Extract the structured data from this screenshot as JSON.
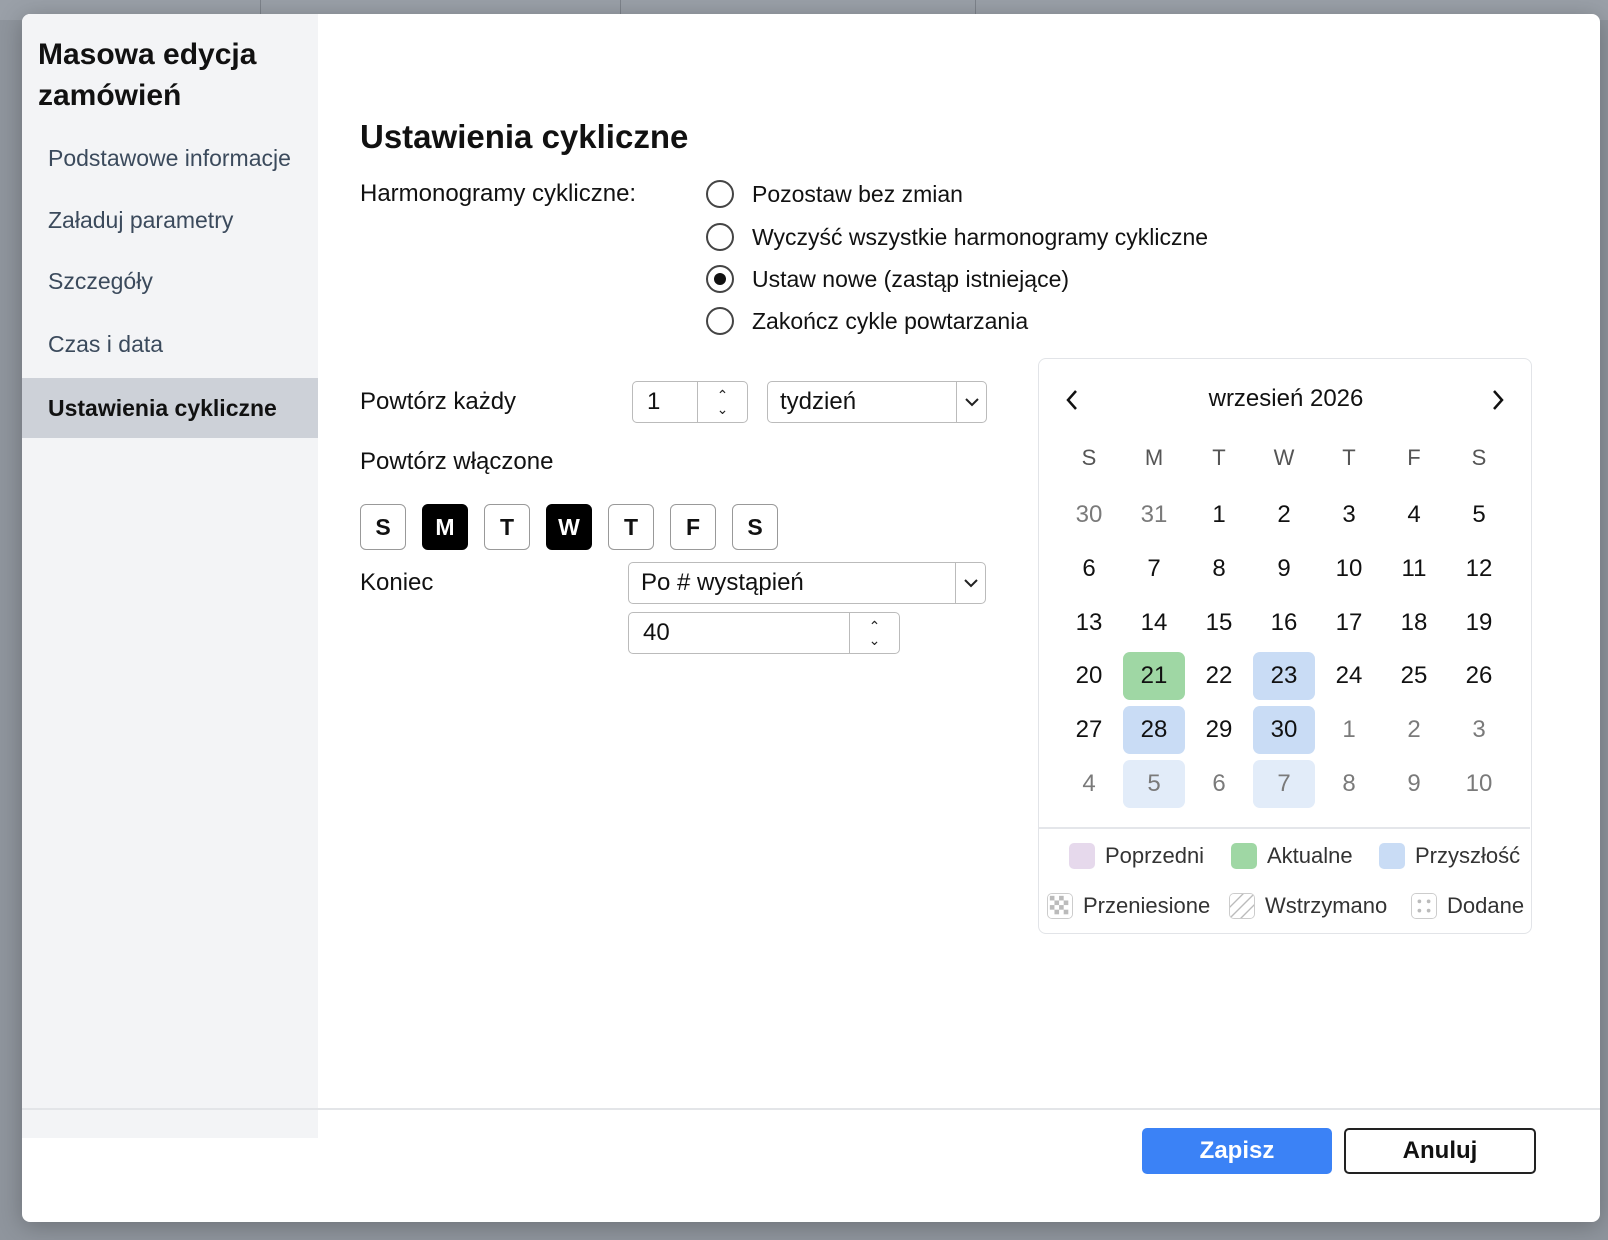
{
  "modal": {
    "title": "Masowa edycja zamówień"
  },
  "sidebar": {
    "items": [
      {
        "label": "Podstawowe informacje"
      },
      {
        "label": "Załaduj parametry"
      },
      {
        "label": "Szczegóły"
      },
      {
        "label": "Czas i data"
      },
      {
        "label": "Ustawienia cykliczne",
        "active": true
      }
    ]
  },
  "section": {
    "title": "Ustawienia cykliczne"
  },
  "cyclic": {
    "label": "Harmonogramy cykliczne:",
    "options": [
      {
        "label": "Pozostaw bez zmian",
        "selected": false
      },
      {
        "label": "Wyczyść wszystkie harmonogramy cykliczne",
        "selected": false
      },
      {
        "label": "Ustaw nowe (zastąp istniejące)",
        "selected": true
      },
      {
        "label": "Zakończ cykle powtarzania",
        "selected": false
      }
    ]
  },
  "repeat": {
    "every_label": "Powtórz każdy",
    "every_value": "1",
    "unit_value": "tydzień",
    "on_label": "Powtórz włączone",
    "days": [
      {
        "label": "S",
        "on": false
      },
      {
        "label": "M",
        "on": true
      },
      {
        "label": "T",
        "on": false
      },
      {
        "label": "W",
        "on": true
      },
      {
        "label": "T",
        "on": false
      },
      {
        "label": "F",
        "on": false
      },
      {
        "label": "S",
        "on": false
      }
    ]
  },
  "end": {
    "label": "Koniec",
    "mode_value": "Po # wystąpień",
    "count_value": "40"
  },
  "calendar": {
    "title": "wrzesień 2026",
    "weekdays": [
      "S",
      "M",
      "T",
      "W",
      "T",
      "F",
      "S"
    ],
    "weeks": [
      [
        {
          "d": "30",
          "o": true
        },
        {
          "d": "31",
          "o": true
        },
        {
          "d": "1"
        },
        {
          "d": "2"
        },
        {
          "d": "3"
        },
        {
          "d": "4"
        },
        {
          "d": "5"
        }
      ],
      [
        {
          "d": "6"
        },
        {
          "d": "7"
        },
        {
          "d": "8"
        },
        {
          "d": "9"
        },
        {
          "d": "10"
        },
        {
          "d": "11"
        },
        {
          "d": "12"
        }
      ],
      [
        {
          "d": "13"
        },
        {
          "d": "14"
        },
        {
          "d": "15"
        },
        {
          "d": "16"
        },
        {
          "d": "17"
        },
        {
          "d": "18"
        },
        {
          "d": "19"
        }
      ],
      [
        {
          "d": "20"
        },
        {
          "d": "21",
          "s": "current"
        },
        {
          "d": "22"
        },
        {
          "d": "23",
          "s": "future"
        },
        {
          "d": "24"
        },
        {
          "d": "25"
        },
        {
          "d": "26"
        }
      ],
      [
        {
          "d": "27"
        },
        {
          "d": "28",
          "s": "future"
        },
        {
          "d": "29"
        },
        {
          "d": "30",
          "s": "future"
        },
        {
          "d": "1",
          "o": true
        },
        {
          "d": "2",
          "o": true
        },
        {
          "d": "3",
          "o": true
        }
      ],
      [
        {
          "d": "4",
          "o": true
        },
        {
          "d": "5",
          "o": true,
          "s": "future"
        },
        {
          "d": "6",
          "o": true
        },
        {
          "d": "7",
          "o": true,
          "s": "future"
        },
        {
          "d": "8",
          "o": true
        },
        {
          "d": "9",
          "o": true
        },
        {
          "d": "10",
          "o": true
        }
      ]
    ],
    "legend": [
      {
        "label": "Poprzedni",
        "color": "#e6d9ec"
      },
      {
        "label": "Aktualne",
        "color": "#9fd7a4"
      },
      {
        "label": "Przyszłość",
        "color": "#c9dcf5"
      },
      {
        "label": "Przeniesione",
        "icon": "checker-pattern-icon"
      },
      {
        "label": "Wstrzymano",
        "icon": "hatched-pattern-icon"
      },
      {
        "label": "Dodane",
        "icon": "dotted-pattern-icon"
      }
    ]
  },
  "footer": {
    "save_label": "Zapisz",
    "cancel_label": "Anuluj"
  },
  "colors": {
    "accent": "#3b82f6",
    "current": "#9fd7a4",
    "future": "#c9dcf5"
  }
}
